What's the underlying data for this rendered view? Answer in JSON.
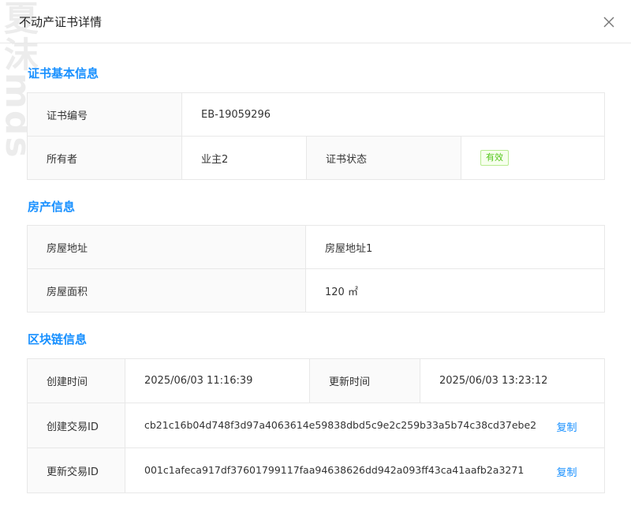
{
  "watermark": "夏沫mds",
  "dialog": {
    "title": "不动产证书详情",
    "close_icon": "close-icon"
  },
  "cert_section": {
    "title": "证书基本信息",
    "cert_no_label": "证书编号",
    "cert_no_value": "EB-19059296",
    "owner_label": "所有者",
    "owner_value": "业主2",
    "status_label": "证书状态",
    "status_value": "有效",
    "status_color": "#52c41a"
  },
  "property_section": {
    "title": "房产信息",
    "address_label": "房屋地址",
    "address_value": "房屋地址1",
    "area_label": "房屋面积",
    "area_value": "120 ㎡"
  },
  "chain_section": {
    "title": "区块链信息",
    "created_label": "创建时间",
    "created_value": "2025/06/03 11:16:39",
    "updated_label": "更新时间",
    "updated_value": "2025/06/03 13:23:12",
    "create_tx_label": "创建交易ID",
    "create_tx_value": "cb21c16b04d748f3d97a4063614e59838dbd5c9e2c259b33a5b74c38cd37ebe2",
    "update_tx_label": "更新交易ID",
    "update_tx_value": "001c1afeca917df37601799117faa94638626dd942a093ff43ca41aafb2a3271",
    "copy_label": "复制"
  },
  "colors": {
    "accent": "#1890ff",
    "label_bg": "#fafafa",
    "border": "#e8e8e8"
  }
}
